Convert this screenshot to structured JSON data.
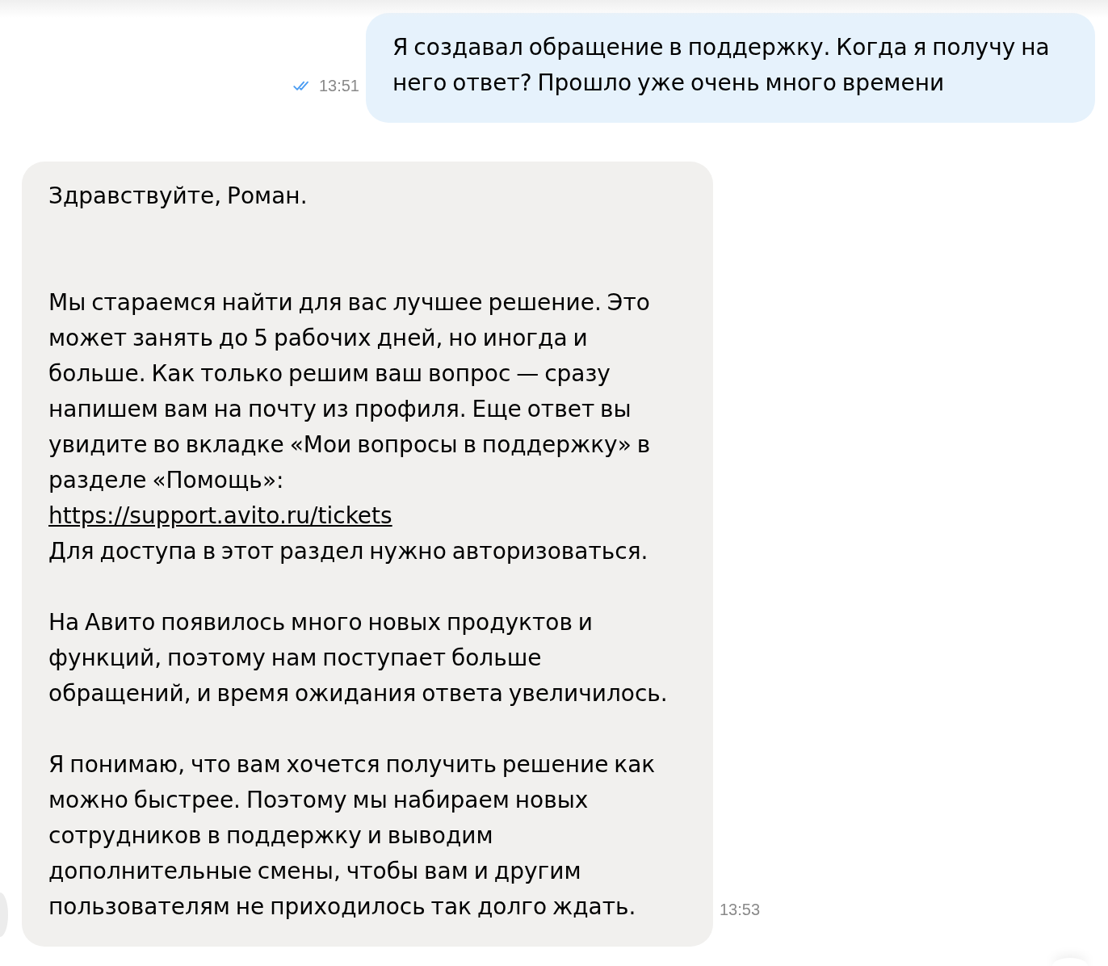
{
  "messages": [
    {
      "kind": "outgoing",
      "read": true,
      "time": "13:51",
      "paragraphs": [
        {
          "parts": [
            {
              "kind": "text",
              "text": "Я создавал обращение в поддержку. Когда я получу на него ответ? Прошло уже очень много времени"
            }
          ]
        }
      ]
    },
    {
      "kind": "incoming",
      "time": "13:53",
      "paragraphs": [
        {
          "parts": [
            {
              "kind": "text",
              "text": "Здравствуйте, Роман."
            }
          ]
        },
        {
          "parts": [
            {
              "kind": "text",
              "text": "Мы стараемся найти для вас лучшее решение. Это может занять до 5 рабочих дней, но иногда и больше. Как только решим ваш вопрос — сразу напишем вам на почту из профиля. Еще ответ вы увидите во вкладке «Мои вопросы в поддержку» в разделе «Помощь»:"
            },
            {
              "kind": "link",
              "text": "https://support.avito.ru/tickets"
            },
            {
              "kind": "text",
              "text": "Для доступа в этот раздел нужно авторизоваться."
            }
          ]
        },
        {
          "parts": [
            {
              "kind": "text",
              "text": "На Авито появилось много новых продуктов и функций, поэтому нам поступает больше обращений, и время ожидания ответа увеличилось."
            }
          ]
        },
        {
          "parts": [
            {
              "kind": "text",
              "text": "Я понимаю, что вам хочется получить решение как можно быстрее. Поэтому мы набираем новых сотрудников в поддержку и выводим дополнительные смены, чтобы вам и другим пользователям не приходилось так долго ждать."
            }
          ]
        }
      ]
    }
  ]
}
